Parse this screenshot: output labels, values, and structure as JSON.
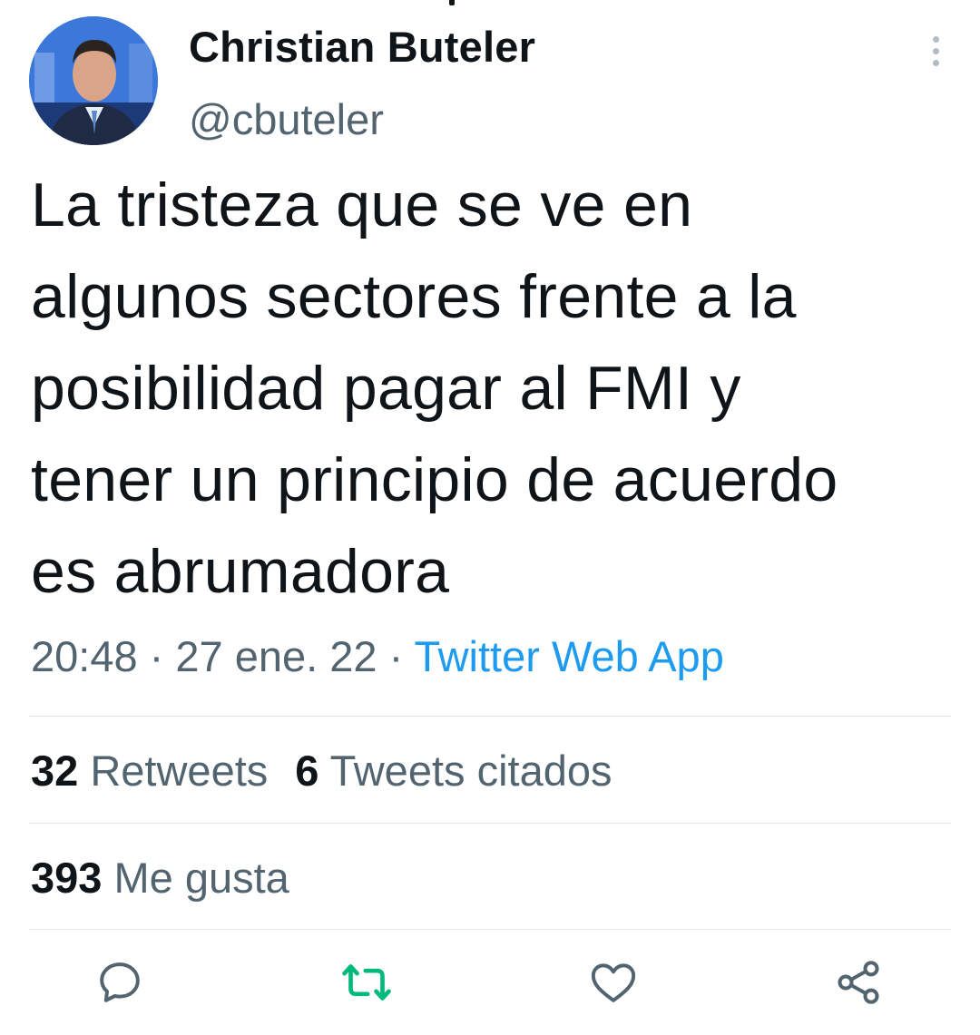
{
  "tweet": {
    "author": {
      "name": "Christian Buteler",
      "handle": "@cbuteler"
    },
    "text": "La tristeza que se ve en\nalgunos sectores frente a la\nposibilidad pagar al FMI y\ntener un principio de acuerdo\nes abrumadora",
    "time": "20:48",
    "date": "27 ene. 22",
    "separator": " · ",
    "source": "Twitter Web App"
  },
  "stats": {
    "retweets_count": "32",
    "retweets_label": "Retweets",
    "quotes_count": "6",
    "quotes_label": "Tweets citados",
    "likes_count": "393",
    "likes_label": "Me gusta"
  },
  "actions": {
    "icons": [
      "reply-icon",
      "retweet-icon",
      "like-icon",
      "share-icon"
    ]
  },
  "colors": {
    "text": "#0f1419",
    "secondary": "#536471",
    "link": "#1d9bf0",
    "retweet_green": "#00ba7c",
    "divider": "#e4e8eb"
  }
}
